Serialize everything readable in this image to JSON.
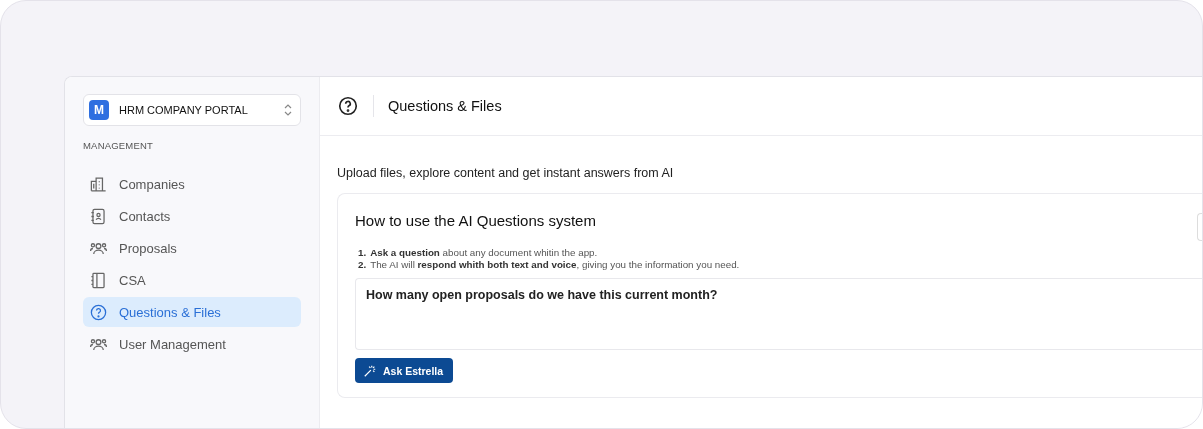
{
  "workspace": {
    "name": "HRM COMPANY PORTAL",
    "logo": "M"
  },
  "sidebar": {
    "section": "MANAGEMENT",
    "items": [
      {
        "label": "Companies",
        "kind": "building",
        "selected": false
      },
      {
        "label": "Contacts",
        "kind": "contact",
        "selected": false
      },
      {
        "label": "Proposals",
        "kind": "users",
        "selected": false
      },
      {
        "label": "CSA",
        "kind": "book",
        "selected": false
      },
      {
        "label": "Questions & Files",
        "kind": "question",
        "selected": true
      },
      {
        "label": "User Management",
        "kind": "users",
        "selected": false
      }
    ]
  },
  "header": {
    "title": "Questions & Files"
  },
  "intro": "Upload files, explore content and get instant answers from AI",
  "card": {
    "title": "How to use the AI Questions system",
    "steps": [
      {
        "number": "1.",
        "text": "**Ask a question** about any document whitin the app."
      },
      {
        "number": "2.",
        "text": "The AI will **respond whith both text and voice**, giving you the information you need."
      }
    ],
    "question": {
      "value": "How many open proposals do we have this current month?"
    },
    "button": "Ask Estrella"
  }
}
